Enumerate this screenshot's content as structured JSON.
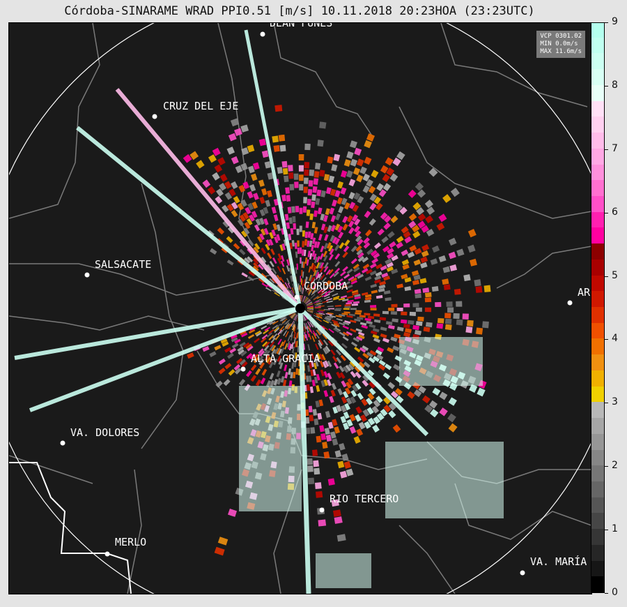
{
  "title": "Córdoba-SINARAME WRAD PPI0.51 [m/s] 10.11.2018 20:23HOA (23:23UTC)",
  "info_box": {
    "line1": "VCP 0301.02",
    "line2": "MIN 0.0m/s",
    "line3": "MAX 11.6m/s"
  },
  "cities": [
    {
      "name": "DEAN FUNES"
    },
    {
      "name": "CRUZ DEL EJE"
    },
    {
      "name": "SALSACATE"
    },
    {
      "name": "CORDOBA"
    },
    {
      "name": "ALTA GRACIA"
    },
    {
      "name": "VA. DOLORES"
    },
    {
      "name": "RIO TERCERO"
    },
    {
      "name": "MERLO"
    },
    {
      "name": "VA. MARÍA"
    },
    {
      "name": "AR"
    }
  ],
  "colorbar": {
    "ticks": [
      "0",
      "1",
      "2",
      "3",
      "4",
      "5",
      "6",
      "7",
      "8",
      "9"
    ],
    "colors": [
      "#000000",
      "#161616",
      "#262626",
      "#363636",
      "#464646",
      "#565656",
      "#666666",
      "#767676",
      "#868686",
      "#969696",
      "#a6a6a6",
      "#b8b8b8",
      "#f0d000",
      "#f0b000",
      "#f09010",
      "#f07000",
      "#f05000",
      "#e03000",
      "#d01800",
      "#c00800",
      "#a80000",
      "#8c0000",
      "#ff00a0",
      "#ff20b0",
      "#ff50c8",
      "#ff70d0",
      "#ff90dc",
      "#ffa8e4",
      "#ffbcea",
      "#ffd0f0",
      "#ffe0f6",
      "#e8fff8",
      "#d8fff4",
      "#ccfff2",
      "#c0fff0",
      "#b4ffee"
    ]
  },
  "colors": {
    "background": "#1a1a1a",
    "borders": "#7a7a7a",
    "radar_site": "#000000"
  }
}
